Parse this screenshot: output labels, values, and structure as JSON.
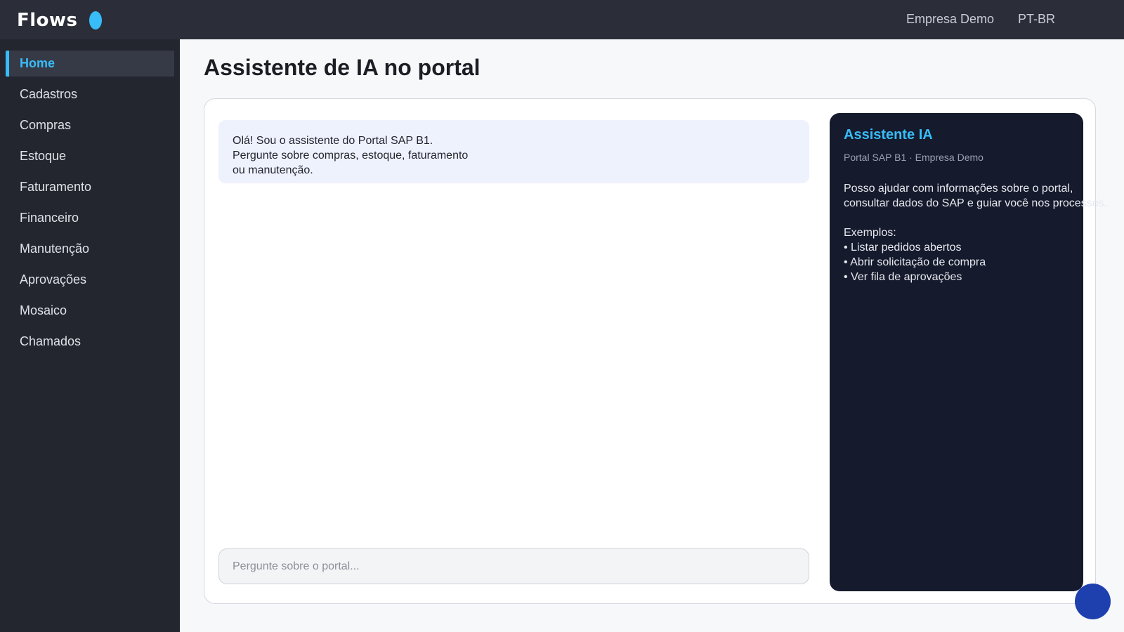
{
  "app": {
    "brand": "Flows"
  },
  "topbar": {
    "company": "Empresa Demo",
    "language": "PT-BR"
  },
  "sidebar": {
    "items": [
      {
        "label": "Home",
        "active": true
      },
      {
        "label": "Cadastros"
      },
      {
        "label": "Compras"
      },
      {
        "label": "Estoque"
      },
      {
        "label": "Faturamento"
      },
      {
        "label": "Financeiro"
      },
      {
        "label": "Manutenção"
      },
      {
        "label": "Aprovações"
      },
      {
        "label": "Mosaico"
      },
      {
        "label": "Chamados"
      }
    ]
  },
  "main": {
    "title": "Assistente de IA no portal",
    "chat": {
      "messages": [
        {
          "from": "assistant",
          "lines": [
            "Olá! Sou o assistente do Portal SAP B1.",
            "Pergunte sobre compras, estoque, faturamento",
            "ou manutenção."
          ]
        }
      ],
      "input": {
        "value": "",
        "placeholder": "Pergunte sobre o portal..."
      }
    },
    "ai_panel": {
      "title": "Assistente IA",
      "subtitle": "Portal SAP B1 · Empresa Demo",
      "description": [
        "Posso ajudar com informações sobre o portal,",
        "consultar dados do SAP e guiar você nos processos."
      ],
      "examples_heading": "Exemplos:",
      "examples": [
        "• Listar pedidos abertos",
        "• Abrir solicitação de compra",
        "• Ver fila de aprovações"
      ]
    }
  },
  "colors": {
    "accent": "#38bdf8",
    "topbar": "#2b2e38",
    "sidebar": "#23262f",
    "panel": "#151a2c",
    "fab": "#1e40af"
  }
}
